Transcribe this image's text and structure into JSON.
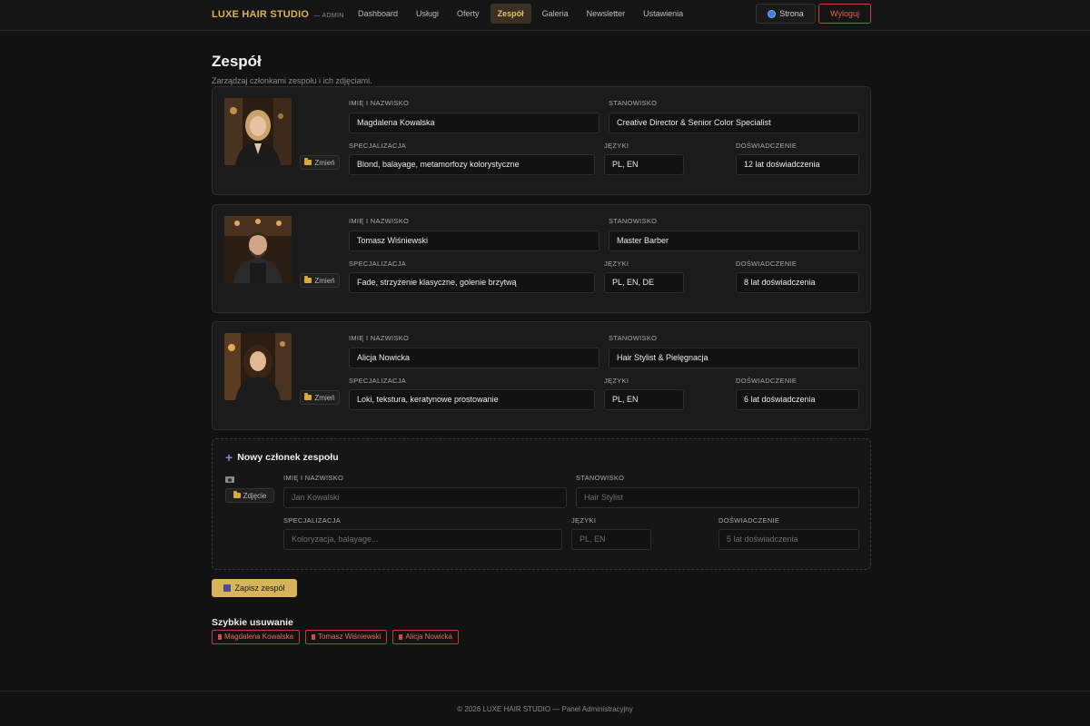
{
  "header": {
    "brand": "LUXE HAIR STUDIO",
    "brand_sub": "— ADMIN",
    "nav": [
      "Dashboard",
      "Usługi",
      "Oferty",
      "Zespół",
      "Galeria",
      "Newsletter",
      "Ustawienia"
    ],
    "active_nav": "Zespół",
    "site_button": "Strona",
    "logout_button": "Wyloguj"
  },
  "page": {
    "title": "Zespół",
    "subtitle": "Zarządzaj członkami zespołu i ich zdjęciami."
  },
  "labels": {
    "name": "IMIĘ I NAZWISKO",
    "position": "STANOWISKO",
    "specialization": "SPECJALIZACJA",
    "languages": "JĘZYKI",
    "experience": "DOŚWIADCZENIE",
    "change_photo": "Zmień",
    "add_photo": "Zdjęcie"
  },
  "members": [
    {
      "name": "Magdalena Kowalska",
      "position": "Creative Director & Senior Color Specialist",
      "specialization": "Blond, balayage, metamorfozy kolorystyczne",
      "languages": "PL, EN",
      "experience": "12 lat doświadczenia"
    },
    {
      "name": "Tomasz Wiśniewski",
      "position": "Master Barber",
      "specialization": "Fade, strzyżenie klasyczne, golenie brzytwą",
      "languages": "PL, EN, DE",
      "experience": "8 lat doświadczenia"
    },
    {
      "name": "Alicja Nowicka",
      "position": "Hair Stylist & Pielęgnacja",
      "specialization": "Loki, tekstura, keratynowe prostowanie",
      "languages": "PL, EN",
      "experience": "6 lat doświadczenia"
    }
  ],
  "new_member": {
    "title": "Nowy członek zespołu",
    "placeholders": {
      "name": "Jan Kowalski",
      "position": "Hair Stylist",
      "specialization": "Koloryzacja, balayage...",
      "languages": "PL, EN",
      "experience": "5 lat doświadczenia"
    }
  },
  "save_button": "Zapisz zespół",
  "quick_delete": {
    "title": "Szybkie usuwanie",
    "items": [
      "Magdalena Kowalska",
      "Tomasz Wiśniewski",
      "Alicja Nowicka"
    ]
  },
  "footer": "© 2026 LUXE HAIR STUDIO — Panel Administracyjny"
}
